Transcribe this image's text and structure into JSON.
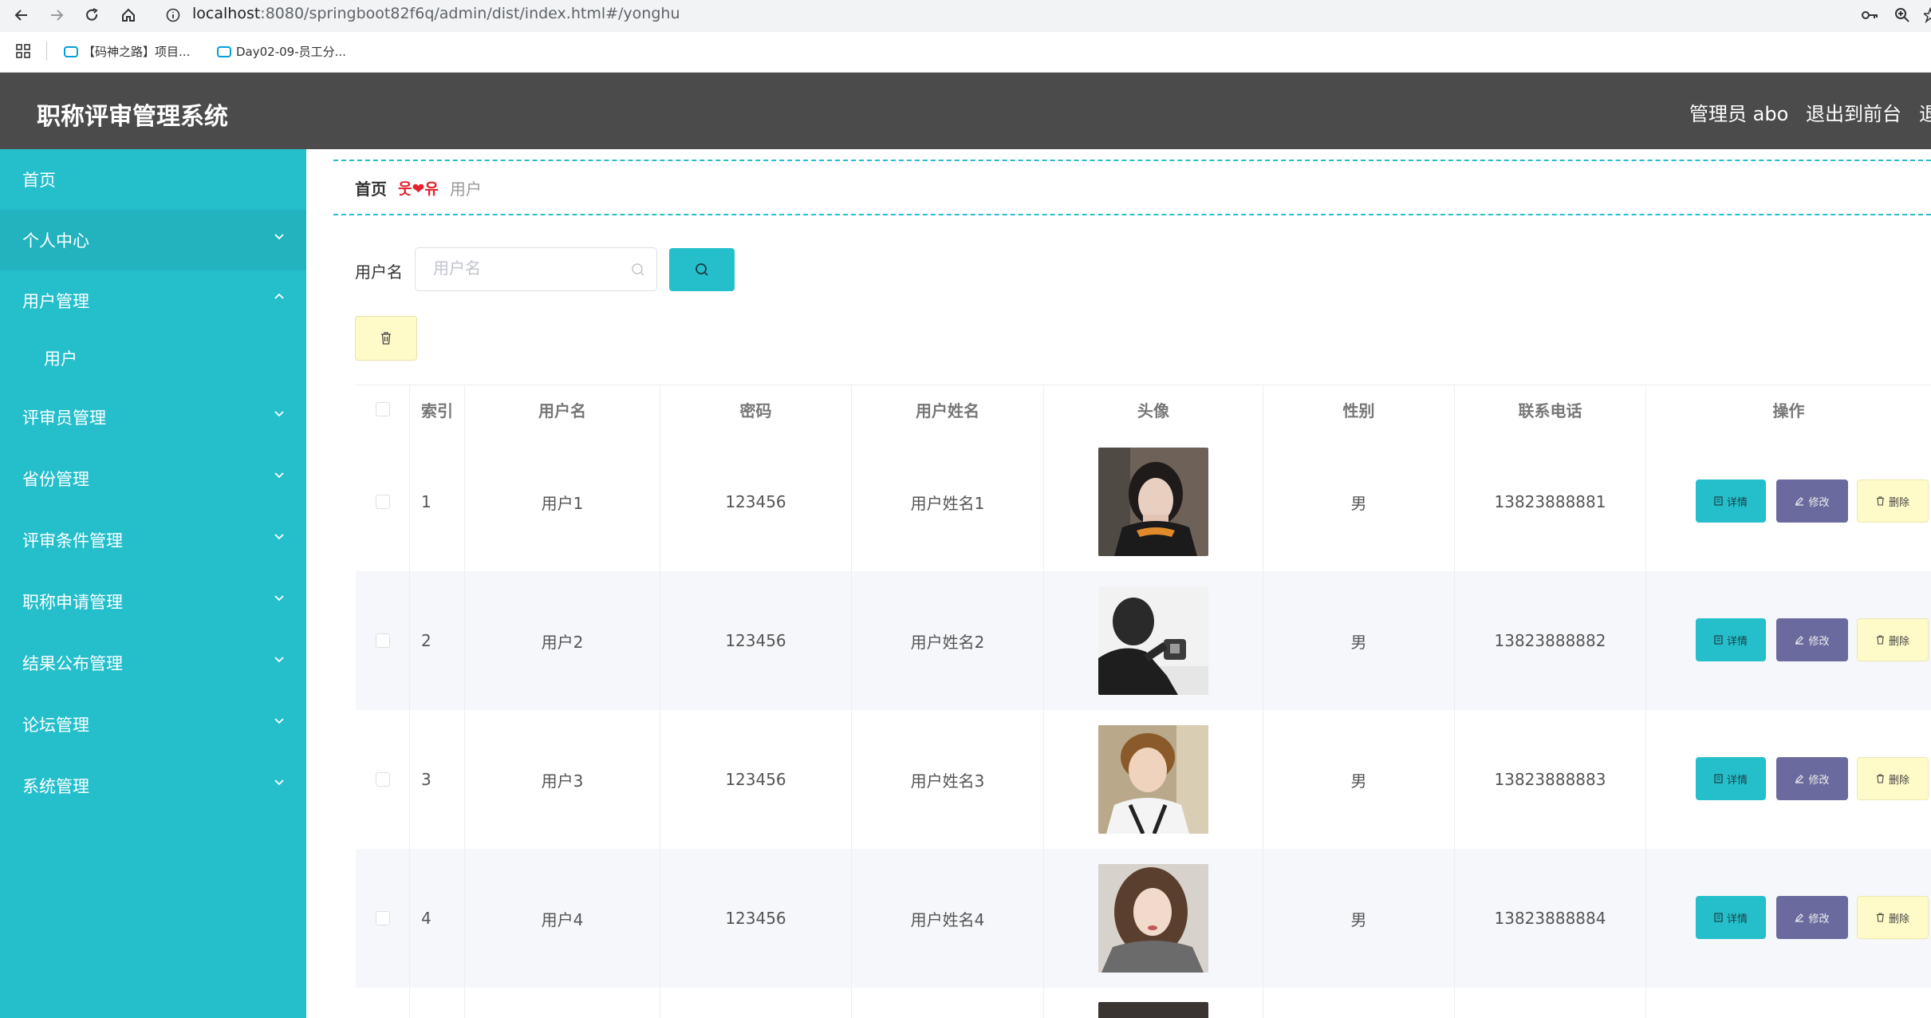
{
  "browser": {
    "url_host": "localhost",
    "url_path": ":8080/springboot82f6q/admin/dist/index.html#/yonghu",
    "bookmarks": [
      "【码神之路】项目...",
      "Day02-09-员工分..."
    ]
  },
  "header": {
    "title": "职称评审管理系统",
    "admin_label": "管理员 abo",
    "exit_front_label": "退出到前台",
    "exit_label": "退"
  },
  "sidebar": {
    "items": [
      {
        "label": "首页"
      },
      {
        "label": "个人中心"
      },
      {
        "label": "用户管理"
      },
      {
        "label": "用户"
      },
      {
        "label": "评审员管理"
      },
      {
        "label": "省份管理"
      },
      {
        "label": "评审条件管理"
      },
      {
        "label": "职称申请管理"
      },
      {
        "label": "结果公布管理"
      },
      {
        "label": "论坛管理"
      },
      {
        "label": "系统管理"
      }
    ]
  },
  "breadcrumb": {
    "home": "首页",
    "separator": "웃❤유",
    "current": "用户"
  },
  "search": {
    "label": "用户名",
    "placeholder": "用户名"
  },
  "table": {
    "columns": [
      "索引",
      "用户名",
      "密码",
      "用户姓名",
      "头像",
      "性别",
      "联系电话",
      "操作"
    ],
    "rows": [
      {
        "index": "1",
        "username": "用户1",
        "password": "123456",
        "name": "用户姓名1",
        "gender": "男",
        "phone": "13823888881"
      },
      {
        "index": "2",
        "username": "用户2",
        "password": "123456",
        "name": "用户姓名2",
        "gender": "男",
        "phone": "13823888882"
      },
      {
        "index": "3",
        "username": "用户3",
        "password": "123456",
        "name": "用户姓名3",
        "gender": "男",
        "phone": "13823888883"
      },
      {
        "index": "4",
        "username": "用户4",
        "password": "123456",
        "name": "用户姓名4",
        "gender": "男",
        "phone": "13823888884"
      }
    ],
    "actions": {
      "detail": "详情",
      "edit": "修改",
      "delete": "删除"
    }
  },
  "colors": {
    "accent": "#25bfcc",
    "header_bg": "#4b4b4b",
    "edit": "#6b6a9f",
    "delete_bg": "#fffbc8"
  }
}
